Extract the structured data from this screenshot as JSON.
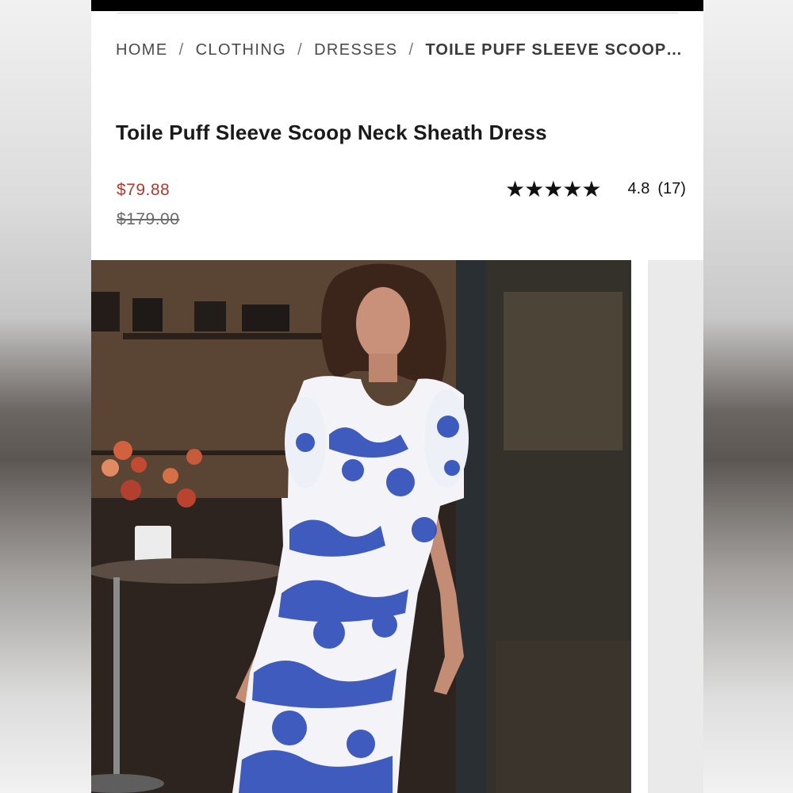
{
  "breadcrumb": {
    "items": [
      "HOME",
      "CLOTHING",
      "DRESSES"
    ],
    "separator": "/",
    "current": "TOILE PUFF SLEEVE SCOOP NE…"
  },
  "product": {
    "title": "Toile Puff Sleeve Scoop Neck Sheath Dress",
    "sale_price": "$79.88",
    "original_price": "$179.00",
    "rating": {
      "stars_display": "★★★★★",
      "value": "4.8",
      "count": "(17)"
    }
  },
  "colors": {
    "sale_price": "#b03a32",
    "dress_print": "#2f4fb8",
    "dress_base": "#f4f4f8"
  }
}
